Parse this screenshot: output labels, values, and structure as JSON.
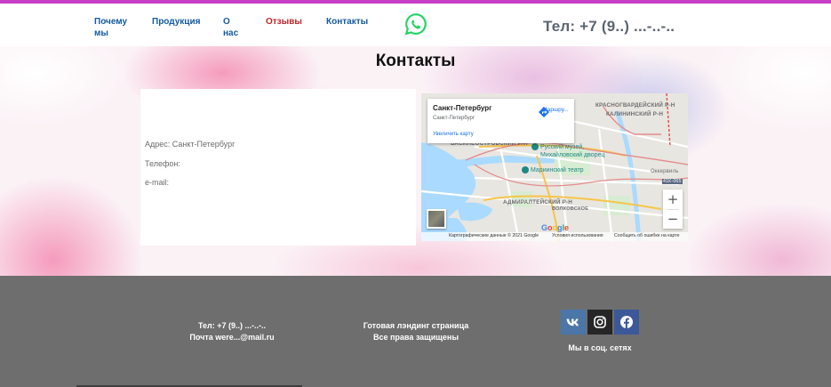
{
  "header": {
    "nav": [
      {
        "label": "Почему мы"
      },
      {
        "label": "Продукция"
      },
      {
        "label": "О нас"
      },
      {
        "label": "Отзывы"
      },
      {
        "label": "Контакты"
      }
    ],
    "phone": "Тел: +7 (9..) ...-..-..",
    "whatsapp_icon": "whatsapp-icon",
    "accent_color": "#c63fc6"
  },
  "contacts": {
    "title": "Контакты",
    "address": "Адрес: Санкт-Петербург",
    "phone_label": "Телефон:",
    "email_label": "e-mail:"
  },
  "map": {
    "place_title": "Санкт-Петербург",
    "place_subtitle": "Санкт-Петербург",
    "enlarge_link": "Увеличить карту",
    "route_label": "Маршру...",
    "zoom_in": "+",
    "zoom_out": "−",
    "labels": {
      "krasnogvardeisky": "КРАСНОГВАРДЕЙСКИЙ Р-Н",
      "kalininsky": "КАЛИНИНСКИЙ Р-Н",
      "vasileostrovsky": "ВАСИЛЕОСТРОВСКИЙ Р-Н",
      "admiralteisky": "АДМИРАЛТЕЙСКИЙ Р-Н",
      "volkovskoe": "ВОЛКОВСКОЕ",
      "okkervil": "Оккервиль",
      "road_41k": "41К-065"
    },
    "pois": {
      "russian_museum": "Русский музей,\nМихайловский дворец",
      "mariinsky": "Мариинский театр"
    },
    "google": "Google",
    "attribution": {
      "data": "Картографические данные © 2021 Google",
      "terms": "Условия использования",
      "report": "Сообщить об ошибке на карте"
    }
  },
  "footer": {
    "phone": "Тел: +7 (9..) ...-..-..",
    "mail": "Почта were...@mail.ru",
    "landing": "Готовая лэндинг страница",
    "rights": "Все права защищены",
    "social_caption": "Мы в соц. сетях",
    "social": [
      {
        "icon": "vk-icon",
        "color": "#4a76a8"
      },
      {
        "icon": "instagram-icon",
        "color": "#262626"
      },
      {
        "icon": "facebook-icon",
        "color": "#3b5998"
      }
    ]
  }
}
